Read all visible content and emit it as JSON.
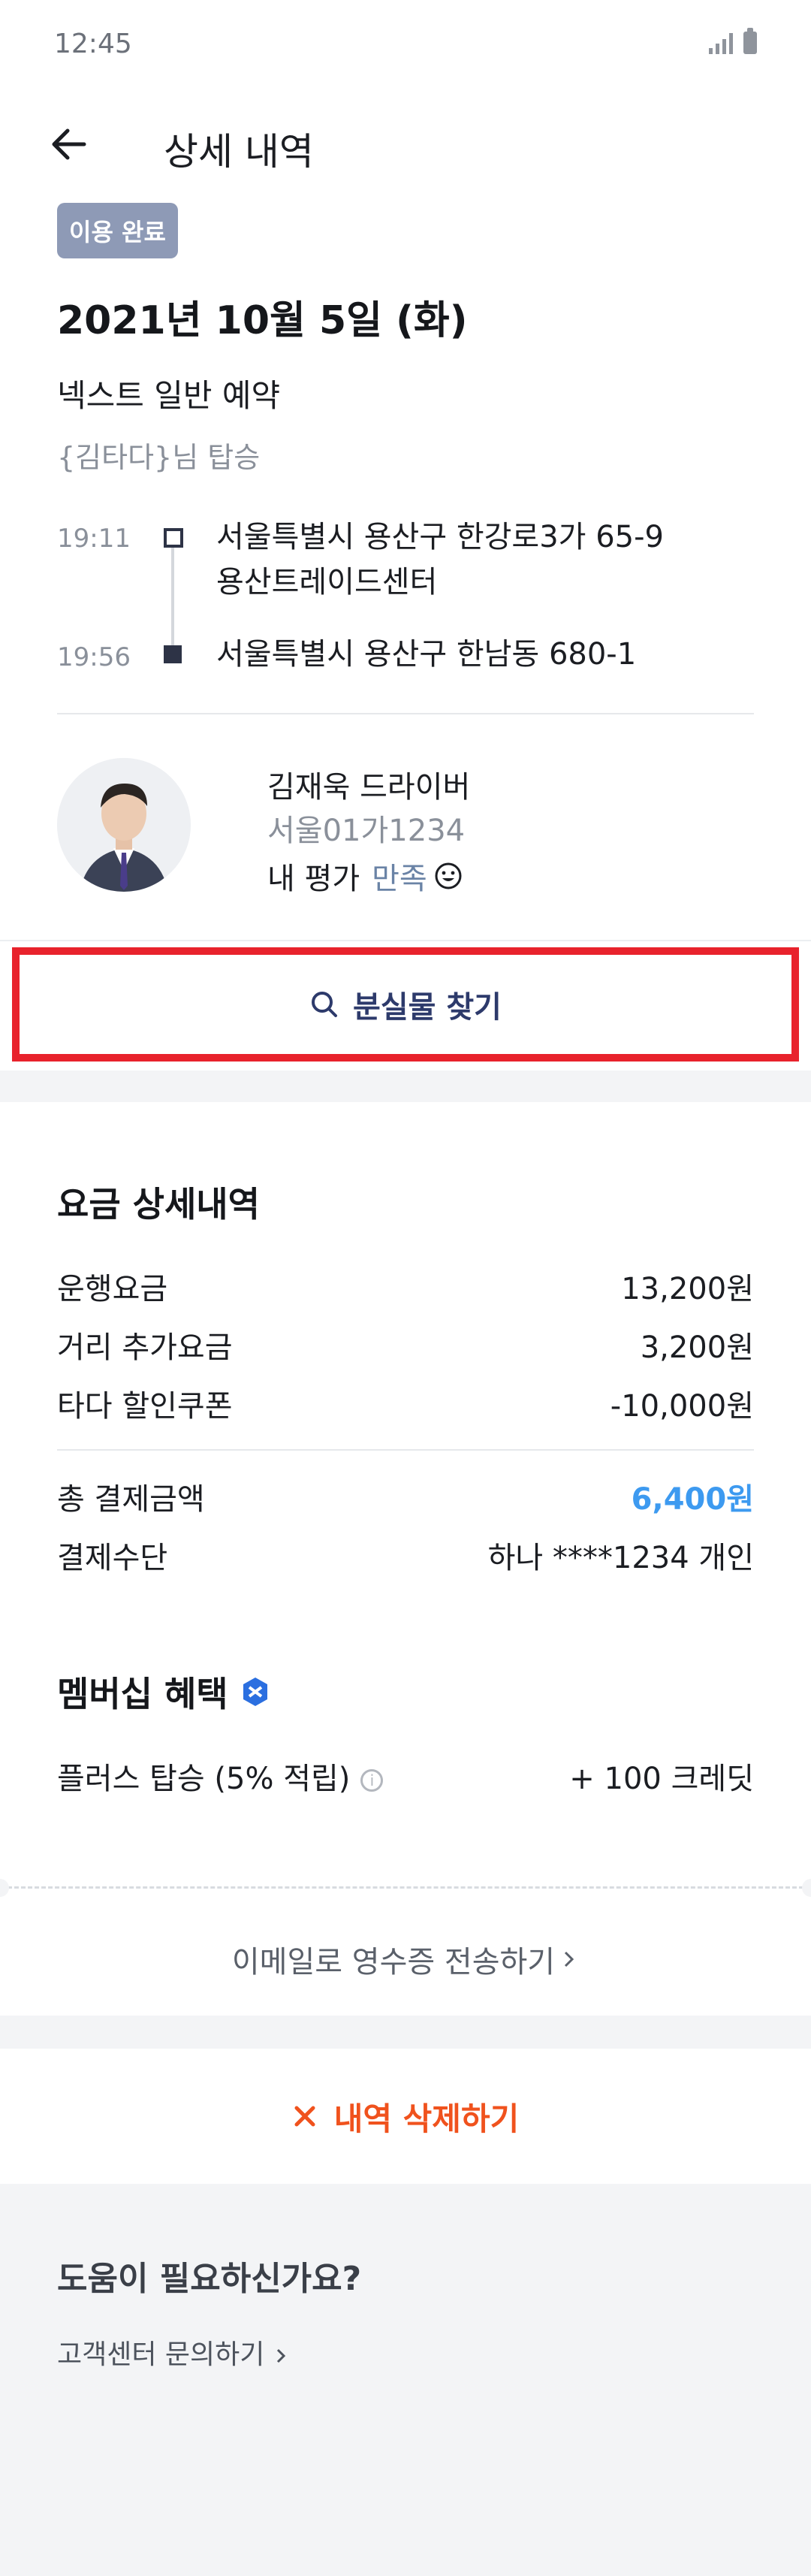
{
  "status_bar": {
    "time": "12:45"
  },
  "header": {
    "title": "상세 내역"
  },
  "ride": {
    "status_badge": "이용 완료",
    "date": "2021년 10월 5일 (화)",
    "type": "넥스트 일반 예약",
    "passenger": "{김타다}님 탑승",
    "origin": {
      "time": "19:11",
      "address_line1": "서울특별시 용산구 한강로3가 65-9",
      "address_line2": "용산트레이드센터"
    },
    "destination": {
      "time": "19:56",
      "address": "서울특별시 용산구 한남동 680-1"
    }
  },
  "driver": {
    "name": "김재욱 드라이버",
    "car_number": "서울01가1234",
    "my_rating_label": "내 평가",
    "my_rating_value": "만족"
  },
  "lost_items_button": "분실물 찾기",
  "fare": {
    "title": "요금 상세내역",
    "rows": [
      {
        "label": "운행요금",
        "value": "13,200원"
      },
      {
        "label": "거리 추가요금",
        "value": "3,200원"
      },
      {
        "label": "타다 할인쿠폰",
        "value": "-10,000원"
      }
    ],
    "total_label": "총 결제금액",
    "total_value": "6,400원",
    "payment_label": "결제수단",
    "payment_value": "하나 ****1234 개인"
  },
  "membership": {
    "title": "멤버십 혜택",
    "benefit_label": "플러스 탑승 (5% 적립)",
    "benefit_value": "+ 100 크레딧"
  },
  "email_receipt": "이메일로 영수증 전송하기",
  "delete_history": "내역 삭제하기",
  "help": {
    "title": "도움이 필요하신가요?",
    "link": "고객센터 문의하기"
  },
  "colors": {
    "accent_blue": "#3d9af0",
    "delete_orange": "#f0521d",
    "highlight_red": "#e8222c",
    "badge_gray": "#8e9ab6"
  }
}
